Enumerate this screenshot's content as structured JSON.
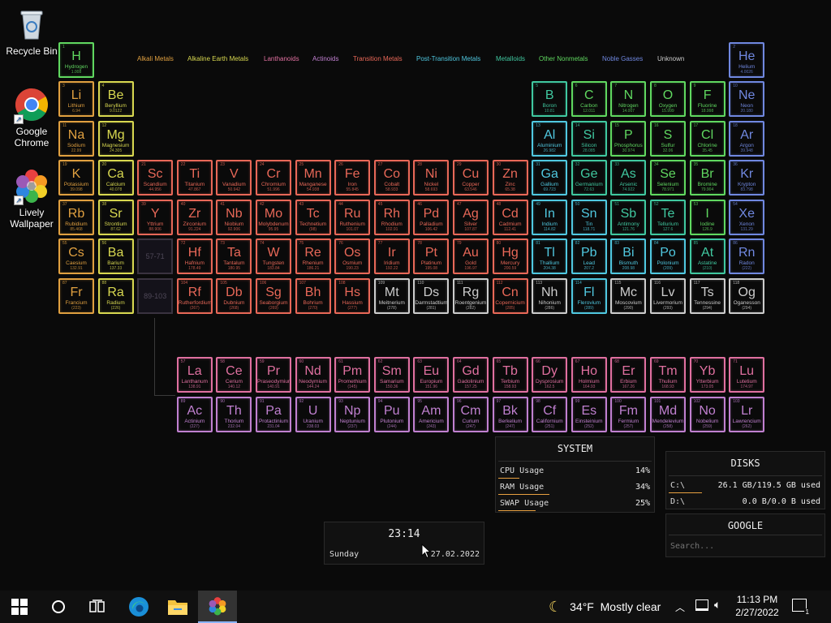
{
  "desktop_icons": [
    {
      "name": "recycle-bin-icon",
      "label": "Recycle Bin"
    },
    {
      "name": "google-chrome-icon",
      "label": "Google Chrome"
    },
    {
      "name": "lively-wallpaper-icon",
      "label": "Lively Wallpaper"
    }
  ],
  "legend": [
    {
      "label": "Alkali Metals",
      "color": "#e0a040"
    },
    {
      "label": "Alkaline Earth Metals",
      "color": "#d8d850"
    },
    {
      "label": "Lanthanoids",
      "color": "#e070a0"
    },
    {
      "label": "Actinoids",
      "color": "#c080d0"
    },
    {
      "label": "Transition Metals",
      "color": "#e86858"
    },
    {
      "label": "Post-Transition Metals",
      "color": "#50c8e0"
    },
    {
      "label": "Metalloids",
      "color": "#40c8a0"
    },
    {
      "label": "Other Nonmetals",
      "color": "#60d860"
    },
    {
      "label": "Noble Gasses",
      "color": "#7088e0"
    },
    {
      "label": "Unknown",
      "color": "#cccccc"
    }
  ],
  "elements": [
    {
      "n": "1",
      "s": "H",
      "name": "Hydrogen",
      "w": "1.008",
      "cat": "nonmetal"
    },
    {
      "n": "2",
      "s": "He",
      "name": "Helium",
      "w": "4.0026",
      "cat": "noble"
    },
    {
      "n": "3",
      "s": "Li",
      "name": "Lithium",
      "w": "6.94",
      "cat": "alkali"
    },
    {
      "n": "4",
      "s": "Be",
      "name": "Beryllium",
      "w": "9.0122",
      "cat": "alkaline"
    },
    {
      "n": "5",
      "s": "B",
      "name": "Boron",
      "w": "10.81",
      "cat": "metalloid"
    },
    {
      "n": "6",
      "s": "C",
      "name": "Carbon",
      "w": "12.011",
      "cat": "nonmetal"
    },
    {
      "n": "7",
      "s": "N",
      "name": "Nitrogen",
      "w": "14.007",
      "cat": "nonmetal"
    },
    {
      "n": "8",
      "s": "O",
      "name": "Oxygen",
      "w": "15.999",
      "cat": "nonmetal"
    },
    {
      "n": "9",
      "s": "F",
      "name": "Fluorine",
      "w": "18.998",
      "cat": "nonmetal"
    },
    {
      "n": "10",
      "s": "Ne",
      "name": "Neon",
      "w": "20.180",
      "cat": "noble"
    },
    {
      "n": "11",
      "s": "Na",
      "name": "Sodium",
      "w": "22.99",
      "cat": "alkali"
    },
    {
      "n": "12",
      "s": "Mg",
      "name": "Magnesium",
      "w": "24.305",
      "cat": "alkaline"
    },
    {
      "n": "13",
      "s": "Al",
      "name": "Aluminium",
      "w": "26.982",
      "cat": "post"
    },
    {
      "n": "14",
      "s": "Si",
      "name": "Silicon",
      "w": "28.085",
      "cat": "metalloid"
    },
    {
      "n": "15",
      "s": "P",
      "name": "Phosphorus",
      "w": "30.974",
      "cat": "nonmetal"
    },
    {
      "n": "16",
      "s": "S",
      "name": "Sulfur",
      "w": "32.06",
      "cat": "nonmetal"
    },
    {
      "n": "17",
      "s": "Cl",
      "name": "Chlorine",
      "w": "35.45",
      "cat": "nonmetal"
    },
    {
      "n": "18",
      "s": "Ar",
      "name": "Argon",
      "w": "39.948",
      "cat": "noble"
    },
    {
      "n": "19",
      "s": "K",
      "name": "Potassium",
      "w": "39.098",
      "cat": "alkali"
    },
    {
      "n": "20",
      "s": "Ca",
      "name": "Calcium",
      "w": "40.078",
      "cat": "alkaline"
    },
    {
      "n": "21",
      "s": "Sc",
      "name": "Scandium",
      "w": "44.956",
      "cat": "transition"
    },
    {
      "n": "22",
      "s": "Ti",
      "name": "Titanium",
      "w": "47.867",
      "cat": "transition"
    },
    {
      "n": "23",
      "s": "V",
      "name": "Vanadium",
      "w": "50.942",
      "cat": "transition"
    },
    {
      "n": "24",
      "s": "Cr",
      "name": "Chromium",
      "w": "51.996",
      "cat": "transition"
    },
    {
      "n": "25",
      "s": "Mn",
      "name": "Manganese",
      "w": "54.938",
      "cat": "transition"
    },
    {
      "n": "26",
      "s": "Fe",
      "name": "Iron",
      "w": "55.845",
      "cat": "transition"
    },
    {
      "n": "27",
      "s": "Co",
      "name": "Cobalt",
      "w": "58.933",
      "cat": "transition"
    },
    {
      "n": "28",
      "s": "Ni",
      "name": "Nickel",
      "w": "58.693",
      "cat": "transition"
    },
    {
      "n": "29",
      "s": "Cu",
      "name": "Copper",
      "w": "63.546",
      "cat": "transition"
    },
    {
      "n": "30",
      "s": "Zn",
      "name": "Zinc",
      "w": "65.38",
      "cat": "transition"
    },
    {
      "n": "31",
      "s": "Ga",
      "name": "Gallium",
      "w": "69.723",
      "cat": "post"
    },
    {
      "n": "32",
      "s": "Ge",
      "name": "Germanium",
      "w": "72.63",
      "cat": "metalloid"
    },
    {
      "n": "33",
      "s": "As",
      "name": "Arsenic",
      "w": "74.922",
      "cat": "metalloid"
    },
    {
      "n": "34",
      "s": "Se",
      "name": "Selenium",
      "w": "78.971",
      "cat": "nonmetal"
    },
    {
      "n": "35",
      "s": "Br",
      "name": "Bromine",
      "w": "79.904",
      "cat": "nonmetal"
    },
    {
      "n": "36",
      "s": "Kr",
      "name": "Krypton",
      "w": "83.798",
      "cat": "noble"
    },
    {
      "n": "37",
      "s": "Rb",
      "name": "Rubidium",
      "w": "85.468",
      "cat": "alkali"
    },
    {
      "n": "38",
      "s": "Sr",
      "name": "Strontium",
      "w": "87.62",
      "cat": "alkaline"
    },
    {
      "n": "39",
      "s": "Y",
      "name": "Yttrium",
      "w": "88.906",
      "cat": "transition"
    },
    {
      "n": "40",
      "s": "Zr",
      "name": "Zirconium",
      "w": "91.224",
      "cat": "transition"
    },
    {
      "n": "41",
      "s": "Nb",
      "name": "Niobium",
      "w": "92.906",
      "cat": "transition"
    },
    {
      "n": "42",
      "s": "Mo",
      "name": "Molybdenum",
      "w": "95.95",
      "cat": "transition"
    },
    {
      "n": "43",
      "s": "Tc",
      "name": "Technetium",
      "w": "(98)",
      "cat": "transition"
    },
    {
      "n": "44",
      "s": "Ru",
      "name": "Ruthenium",
      "w": "101.07",
      "cat": "transition"
    },
    {
      "n": "45",
      "s": "Rh",
      "name": "Rhodium",
      "w": "102.91",
      "cat": "transition"
    },
    {
      "n": "46",
      "s": "Pd",
      "name": "Palladium",
      "w": "106.42",
      "cat": "transition"
    },
    {
      "n": "47",
      "s": "Ag",
      "name": "Silver",
      "w": "107.87",
      "cat": "transition"
    },
    {
      "n": "48",
      "s": "Cd",
      "name": "Cadmium",
      "w": "112.41",
      "cat": "transition"
    },
    {
      "n": "49",
      "s": "In",
      "name": "Indium",
      "w": "114.82",
      "cat": "post"
    },
    {
      "n": "50",
      "s": "Sn",
      "name": "Tin",
      "w": "118.71",
      "cat": "post"
    },
    {
      "n": "51",
      "s": "Sb",
      "name": "Antimony",
      "w": "121.76",
      "cat": "metalloid"
    },
    {
      "n": "52",
      "s": "Te",
      "name": "Tellurium",
      "w": "127.6",
      "cat": "metalloid"
    },
    {
      "n": "53",
      "s": "I",
      "name": "Iodine",
      "w": "126.9",
      "cat": "nonmetal"
    },
    {
      "n": "54",
      "s": "Xe",
      "name": "Xenon",
      "w": "131.29",
      "cat": "noble"
    },
    {
      "n": "55",
      "s": "Cs",
      "name": "Caesium",
      "w": "132.91",
      "cat": "alkali"
    },
    {
      "n": "56",
      "s": "Ba",
      "name": "Barium",
      "w": "137.33",
      "cat": "alkaline"
    },
    {
      "n": "72",
      "s": "Hf",
      "name": "Hafnium",
      "w": "178.49",
      "cat": "transition"
    },
    {
      "n": "73",
      "s": "Ta",
      "name": "Tantalum",
      "w": "180.95",
      "cat": "transition"
    },
    {
      "n": "74",
      "s": "W",
      "name": "Tungsten",
      "w": "183.84",
      "cat": "transition"
    },
    {
      "n": "75",
      "s": "Re",
      "name": "Rhenium",
      "w": "186.21",
      "cat": "transition"
    },
    {
      "n": "76",
      "s": "Os",
      "name": "Osmium",
      "w": "190.23",
      "cat": "transition"
    },
    {
      "n": "77",
      "s": "Ir",
      "name": "Iridium",
      "w": "192.22",
      "cat": "transition"
    },
    {
      "n": "78",
      "s": "Pt",
      "name": "Platinum",
      "w": "195.08",
      "cat": "transition"
    },
    {
      "n": "79",
      "s": "Au",
      "name": "Gold",
      "w": "196.97",
      "cat": "transition"
    },
    {
      "n": "80",
      "s": "Hg",
      "name": "Mercury",
      "w": "200.59",
      "cat": "transition"
    },
    {
      "n": "81",
      "s": "Tl",
      "name": "Thallium",
      "w": "204.38",
      "cat": "post"
    },
    {
      "n": "82",
      "s": "Pb",
      "name": "Lead",
      "w": "207.2",
      "cat": "post"
    },
    {
      "n": "83",
      "s": "Bi",
      "name": "Bismuth",
      "w": "208.98",
      "cat": "post"
    },
    {
      "n": "84",
      "s": "Po",
      "name": "Polonium",
      "w": "(209)",
      "cat": "post"
    },
    {
      "n": "85",
      "s": "At",
      "name": "Astatine",
      "w": "(210)",
      "cat": "metalloid"
    },
    {
      "n": "86",
      "s": "Rn",
      "name": "Radon",
      "w": "(222)",
      "cat": "noble"
    },
    {
      "n": "87",
      "s": "Fr",
      "name": "Francium",
      "w": "(223)",
      "cat": "alkali"
    },
    {
      "n": "88",
      "s": "Ra",
      "name": "Radium",
      "w": "(226)",
      "cat": "alkaline"
    },
    {
      "n": "104",
      "s": "Rf",
      "name": "Rutherfordium",
      "w": "(267)",
      "cat": "transition"
    },
    {
      "n": "105",
      "s": "Db",
      "name": "Dubnium",
      "w": "(268)",
      "cat": "transition"
    },
    {
      "n": "106",
      "s": "Sg",
      "name": "Seaborgium",
      "w": "(269)",
      "cat": "transition"
    },
    {
      "n": "107",
      "s": "Bh",
      "name": "Bohrium",
      "w": "(270)",
      "cat": "transition"
    },
    {
      "n": "108",
      "s": "Hs",
      "name": "Hassium",
      "w": "(277)",
      "cat": "transition"
    },
    {
      "n": "109",
      "s": "Mt",
      "name": "Meitnerium",
      "w": "(278)",
      "cat": "unknown"
    },
    {
      "n": "110",
      "s": "Ds",
      "name": "Darmstadtium",
      "w": "(281)",
      "cat": "unknown"
    },
    {
      "n": "111",
      "s": "Rg",
      "name": "Roentgenium",
      "w": "(282)",
      "cat": "unknown"
    },
    {
      "n": "112",
      "s": "Cn",
      "name": "Copernicium",
      "w": "(285)",
      "cat": "transition"
    },
    {
      "n": "113",
      "s": "Nh",
      "name": "Nihonium",
      "w": "(286)",
      "cat": "unknown"
    },
    {
      "n": "114",
      "s": "Fl",
      "name": "Flerovium",
      "w": "(289)",
      "cat": "post"
    },
    {
      "n": "115",
      "s": "Mc",
      "name": "Moscovium",
      "w": "(290)",
      "cat": "unknown"
    },
    {
      "n": "116",
      "s": "Lv",
      "name": "Livermorium",
      "w": "(293)",
      "cat": "unknown"
    },
    {
      "n": "117",
      "s": "Ts",
      "name": "Tennessine",
      "w": "(294)",
      "cat": "unknown"
    },
    {
      "n": "118",
      "s": "Og",
      "name": "Oganesson",
      "w": "(294)",
      "cat": "unknown"
    },
    {
      "n": "57",
      "s": "La",
      "name": "Lanthanum",
      "w": "138.91",
      "cat": "lanthanoid"
    },
    {
      "n": "58",
      "s": "Ce",
      "name": "Cerium",
      "w": "140.12",
      "cat": "lanthanoid"
    },
    {
      "n": "59",
      "s": "Pr",
      "name": "Praseodymium",
      "w": "140.91",
      "cat": "lanthanoid"
    },
    {
      "n": "60",
      "s": "Nd",
      "name": "Neodymium",
      "w": "144.24",
      "cat": "lanthanoid"
    },
    {
      "n": "61",
      "s": "Pm",
      "name": "Promethium",
      "w": "(145)",
      "cat": "lanthanoid"
    },
    {
      "n": "62",
      "s": "Sm",
      "name": "Samarium",
      "w": "150.36",
      "cat": "lanthanoid"
    },
    {
      "n": "63",
      "s": "Eu",
      "name": "Europium",
      "w": "151.96",
      "cat": "lanthanoid"
    },
    {
      "n": "64",
      "s": "Gd",
      "name": "Gadolinium",
      "w": "157.25",
      "cat": "lanthanoid"
    },
    {
      "n": "65",
      "s": "Tb",
      "name": "Terbium",
      "w": "158.93",
      "cat": "lanthanoid"
    },
    {
      "n": "66",
      "s": "Dy",
      "name": "Dysprosium",
      "w": "162.5",
      "cat": "lanthanoid"
    },
    {
      "n": "67",
      "s": "Ho",
      "name": "Holmium",
      "w": "164.93",
      "cat": "lanthanoid"
    },
    {
      "n": "68",
      "s": "Er",
      "name": "Erbium",
      "w": "167.26",
      "cat": "lanthanoid"
    },
    {
      "n": "69",
      "s": "Tm",
      "name": "Thulium",
      "w": "168.93",
      "cat": "lanthanoid"
    },
    {
      "n": "70",
      "s": "Yb",
      "name": "Ytterbium",
      "w": "173.05",
      "cat": "lanthanoid"
    },
    {
      "n": "71",
      "s": "Lu",
      "name": "Lutetium",
      "w": "174.97",
      "cat": "lanthanoid"
    },
    {
      "n": "89",
      "s": "Ac",
      "name": "Actinium",
      "w": "(227)",
      "cat": "actinoid"
    },
    {
      "n": "90",
      "s": "Th",
      "name": "Thorium",
      "w": "232.04",
      "cat": "actinoid"
    },
    {
      "n": "91",
      "s": "Pa",
      "name": "Protactinium",
      "w": "231.04",
      "cat": "actinoid"
    },
    {
      "n": "92",
      "s": "U",
      "name": "Uranium",
      "w": "238.03",
      "cat": "actinoid"
    },
    {
      "n": "93",
      "s": "Np",
      "name": "Neptunium",
      "w": "(237)",
      "cat": "actinoid"
    },
    {
      "n": "94",
      "s": "Pu",
      "name": "Plutonium",
      "w": "(244)",
      "cat": "actinoid"
    },
    {
      "n": "95",
      "s": "Am",
      "name": "Americium",
      "w": "(243)",
      "cat": "actinoid"
    },
    {
      "n": "96",
      "s": "Cm",
      "name": "Curium",
      "w": "(247)",
      "cat": "actinoid"
    },
    {
      "n": "97",
      "s": "Bk",
      "name": "Berkelium",
      "w": "(247)",
      "cat": "actinoid"
    },
    {
      "n": "98",
      "s": "Cf",
      "name": "Californium",
      "w": "(251)",
      "cat": "actinoid"
    },
    {
      "n": "99",
      "s": "Es",
      "name": "Einsteinium",
      "w": "(252)",
      "cat": "actinoid"
    },
    {
      "n": "100",
      "s": "Fm",
      "name": "Fermium",
      "w": "(257)",
      "cat": "actinoid"
    },
    {
      "n": "101",
      "s": "Md",
      "name": "Mendelevium",
      "w": "(258)",
      "cat": "actinoid"
    },
    {
      "n": "102",
      "s": "No",
      "name": "Nobelium",
      "w": "(259)",
      "cat": "actinoid"
    },
    {
      "n": "103",
      "s": "Lr",
      "name": "Lawrencium",
      "w": "(262)",
      "cat": "actinoid"
    }
  ],
  "placeholders": [
    "57-71",
    "89-103"
  ],
  "category_colors": {
    "alkali": "#e0a040",
    "alkaline": "#d8d850",
    "transition": "#e86858",
    "post": "#50c8e0",
    "metalloid": "#40c8a0",
    "nonmetal": "#60d860",
    "noble": "#7088e0",
    "lanthanoid": "#e070a0",
    "actinoid": "#c080d0",
    "unknown": "#cccccc"
  },
  "system": {
    "title": "SYSTEM",
    "rows": [
      {
        "label": "CPU Usage",
        "value": "14%",
        "pct": 14
      },
      {
        "label": "RAM Usage",
        "value": "34%",
        "pct": 34
      },
      {
        "label": "SWAP Usage",
        "value": "25%",
        "pct": 25
      }
    ]
  },
  "disks": {
    "title": "DISKS",
    "rows": [
      {
        "label": "C:\\",
        "value": "26.1 GB/119.5 GB used",
        "pct": 22
      },
      {
        "label": "D:\\",
        "value": "0.0 B/0.0 B used",
        "pct": 0
      }
    ]
  },
  "google": {
    "title": "GOOGLE",
    "placeholder": "Search..."
  },
  "clock": {
    "time": "23:14",
    "day": "Sunday",
    "date": "27.02.2022"
  },
  "taskbar": {
    "apps": [
      "start-button",
      "search-button",
      "task-view-button",
      "edge-button",
      "file-explorer-button",
      "lively-wallpaper-button"
    ],
    "weather": "34°F  Mostly clear",
    "time": "11:13 PM",
    "date": "2/27/2022",
    "notifications": "1"
  }
}
